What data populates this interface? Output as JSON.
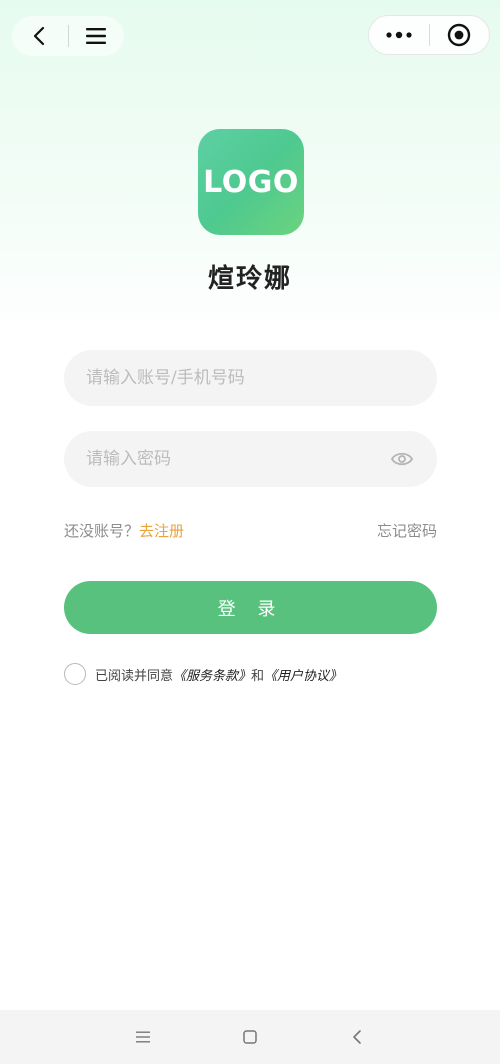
{
  "header": {
    "back_icon": "chevron-left-icon",
    "menu_icon": "hamburger-menu-icon",
    "more_icon": "more-dots-icon",
    "close_icon": "target-circle-icon"
  },
  "brand": {
    "logo_text": "LOGO",
    "app_name": "煊玲娜",
    "logo_gradient": [
      "#5ed0a5",
      "#6bd47e"
    ]
  },
  "form": {
    "account_placeholder": "请输入账号/手机号码",
    "account_value": "",
    "password_placeholder": "请输入密码",
    "password_value": "",
    "password_toggle_icon": "eye-icon"
  },
  "links": {
    "no_account_text": "还没账号？",
    "register_text": "去注册",
    "forgot_text": "忘记密码"
  },
  "login": {
    "label": "登 录"
  },
  "agreement": {
    "prefix": "已阅读并同意",
    "terms": "《服务条款》",
    "and": "和",
    "privacy": "《用户协议》",
    "checked": false
  },
  "colors": {
    "accent": "#58c17e",
    "link": "#e8a33c"
  },
  "system_nav": {
    "menu_icon": "menu-lines-icon",
    "home_icon": "square-home-icon",
    "back_icon": "back-chevron-icon"
  }
}
